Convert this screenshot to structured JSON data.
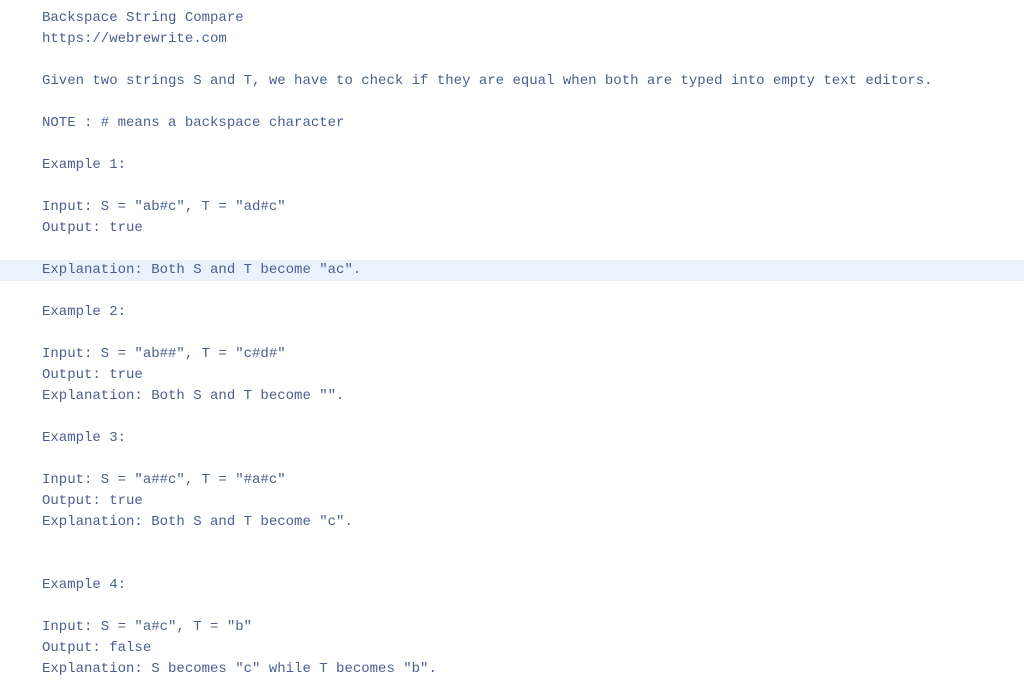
{
  "lines": [
    {
      "text": "Backspace String Compare",
      "highlighted": false
    },
    {
      "text": "https://webrewrite.com",
      "highlighted": false
    },
    {
      "text": "",
      "highlighted": false
    },
    {
      "text": "Given two strings S and T, we have to check if they are equal when both are typed into empty text editors.",
      "highlighted": false
    },
    {
      "text": "",
      "highlighted": false
    },
    {
      "text": "NOTE : # means a backspace character",
      "highlighted": false
    },
    {
      "text": "",
      "highlighted": false
    },
    {
      "text": "Example 1:",
      "highlighted": false
    },
    {
      "text": "",
      "highlighted": false
    },
    {
      "text": "Input: S = \"ab#c\", T = \"ad#c\"",
      "highlighted": false
    },
    {
      "text": "Output: true",
      "highlighted": false
    },
    {
      "text": "",
      "highlighted": false
    },
    {
      "text": "Explanation: Both S and T become \"ac\".",
      "highlighted": true
    },
    {
      "text": "",
      "highlighted": false
    },
    {
      "text": "Example 2:",
      "highlighted": false
    },
    {
      "text": "",
      "highlighted": false
    },
    {
      "text": "Input: S = \"ab##\", T = \"c#d#\"",
      "highlighted": false
    },
    {
      "text": "Output: true",
      "highlighted": false
    },
    {
      "text": "Explanation: Both S and T become \"\".",
      "highlighted": false
    },
    {
      "text": "",
      "highlighted": false
    },
    {
      "text": "Example 3:",
      "highlighted": false
    },
    {
      "text": "",
      "highlighted": false
    },
    {
      "text": "Input: S = \"a##c\", T = \"#a#c\"",
      "highlighted": false
    },
    {
      "text": "Output: true",
      "highlighted": false
    },
    {
      "text": "Explanation: Both S and T become \"c\".",
      "highlighted": false
    },
    {
      "text": "",
      "highlighted": false
    },
    {
      "text": "",
      "highlighted": false
    },
    {
      "text": "Example 4:",
      "highlighted": false
    },
    {
      "text": "",
      "highlighted": false
    },
    {
      "text": "Input: S = \"a#c\", T = \"b\"",
      "highlighted": false
    },
    {
      "text": "Output: false",
      "highlighted": false
    },
    {
      "text": "Explanation: S becomes \"c\" while T becomes \"b\".",
      "highlighted": false
    }
  ]
}
